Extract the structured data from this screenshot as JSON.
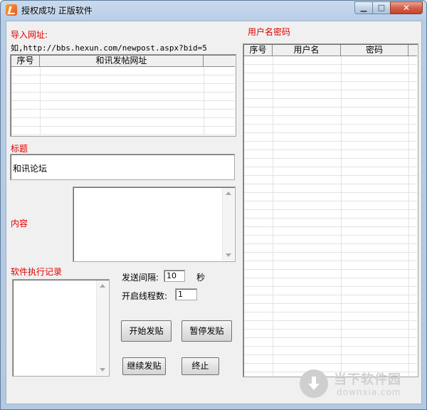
{
  "window": {
    "title": "授权成功 正版软件",
    "min_glyph": "▁",
    "max_glyph": "□",
    "close_glyph": "✕"
  },
  "import": {
    "label": "导入网址:",
    "example": "如,http://bbs.hexun.com/newpost.aspx?bid=5",
    "columns": [
      "序号",
      "和讯发帖网址",
      ""
    ]
  },
  "accounts": {
    "label": "用户名密码",
    "columns": [
      "序号",
      "用户名",
      "密码",
      ""
    ]
  },
  "post": {
    "title_label": "标题",
    "title_value": "和讯论坛",
    "content_label": "内容",
    "content_value": ""
  },
  "log": {
    "label": "软件执行记录"
  },
  "settings": {
    "interval_label": "发送间隔:",
    "interval_value": "10",
    "interval_unit": "秒",
    "threads_label": "开启线程数:",
    "threads_value": "1"
  },
  "buttons": {
    "start": "开始发贴",
    "pause": "暂停发贴",
    "resume": "继续发贴",
    "stop": "终止"
  },
  "watermark": {
    "name": "当下软件园",
    "domain": "downxia.com"
  },
  "colors": {
    "label_red": "#e00000",
    "window_frame": "#b3c9e2",
    "close_red": "#c7442b"
  },
  "icons": {
    "app": "app-icon",
    "download": "download-arrow-icon"
  }
}
